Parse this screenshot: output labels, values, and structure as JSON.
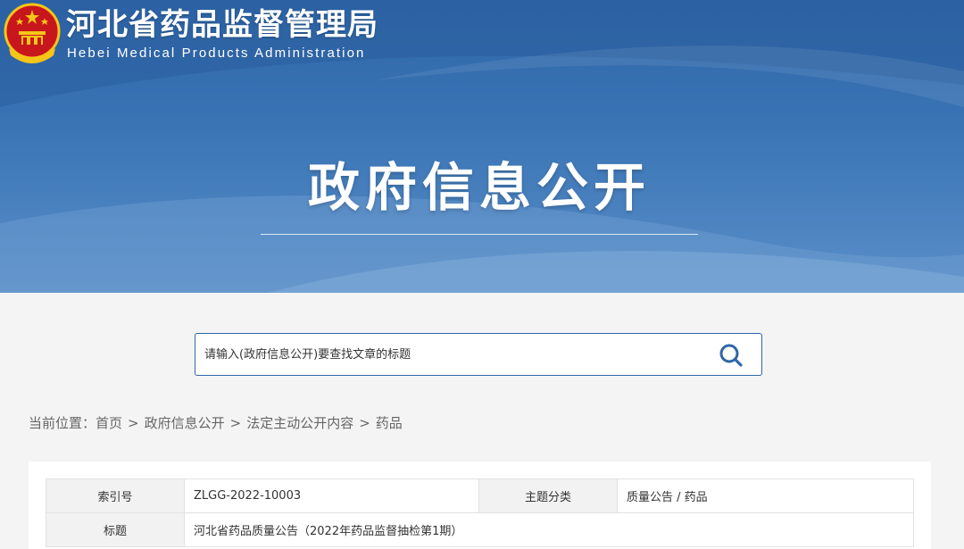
{
  "header": {
    "site_title": "河北省药品监督管理局",
    "site_subtitle": "Hebei Medical Products Administration",
    "section_title": "政府信息公开"
  },
  "search": {
    "placeholder": "请输入(政府信息公开)要查找文章的标题"
  },
  "breadcrumb": {
    "prefix": "当前位置：",
    "items": [
      "首页",
      "政府信息公开",
      "法定主动公开内容",
      "药品"
    ],
    "separator": ">"
  },
  "info_table": {
    "rows": [
      {
        "label1": "索引号",
        "value1": "ZLGG-2022-10003",
        "label2": "主题分类",
        "value2": "质量公告 / 药品"
      },
      {
        "label1": "标题",
        "value1": "河北省药品质量公告（2022年药品监督抽检第1期）"
      }
    ]
  },
  "colors": {
    "banner_blue": "#2f66a8",
    "accent": "#2f66a8",
    "emblem_red": "#c8161d",
    "emblem_gold": "#f5c518"
  },
  "icons": {
    "emblem": "national-emblem-icon",
    "search": "search-icon"
  }
}
